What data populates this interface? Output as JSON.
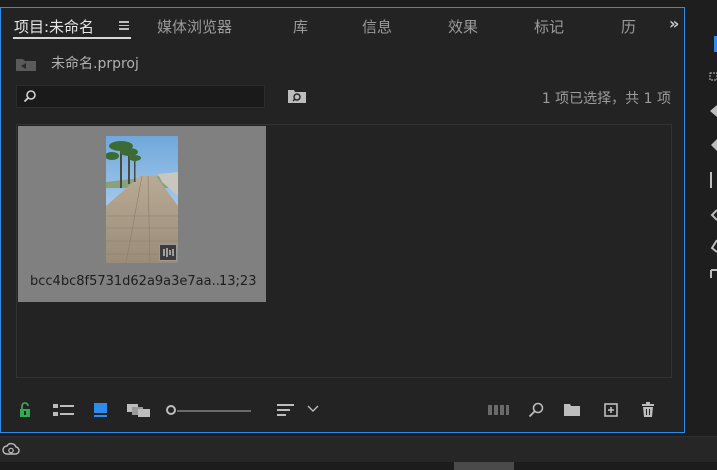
{
  "tabs": [
    {
      "label": "项目:未命名",
      "active": true
    },
    {
      "label": "媒体浏览器",
      "active": false
    },
    {
      "label": "库",
      "active": false
    },
    {
      "label": "信息",
      "active": false
    },
    {
      "label": "效果",
      "active": false
    },
    {
      "label": "标记",
      "active": false
    },
    {
      "label": "历",
      "active": false
    }
  ],
  "overflow_label": "»",
  "project": {
    "file_name": "未命名.prproj"
  },
  "search": {
    "placeholder": ""
  },
  "selection_count": "1 项已选择，共 1 项",
  "clips": [
    {
      "name": "bcc4bc8f5731d62a9a3e7aa...",
      "duration": "13;23"
    }
  ],
  "colors": {
    "accent": "#2d8ceb",
    "panel_bg": "#232323",
    "tile_bg": "#808080",
    "lock_green": "#35a853"
  },
  "icons": {
    "lock": "lock-icon",
    "list_view": "list-view-icon",
    "icon_view": "icon-view-icon",
    "freeform_view": "freeform-view-icon",
    "sort": "sort-icon",
    "automate": "automate-to-sequence-icon",
    "find": "find-icon",
    "new_bin": "new-bin-icon",
    "new_item": "new-item-icon",
    "clear": "trash-icon"
  }
}
